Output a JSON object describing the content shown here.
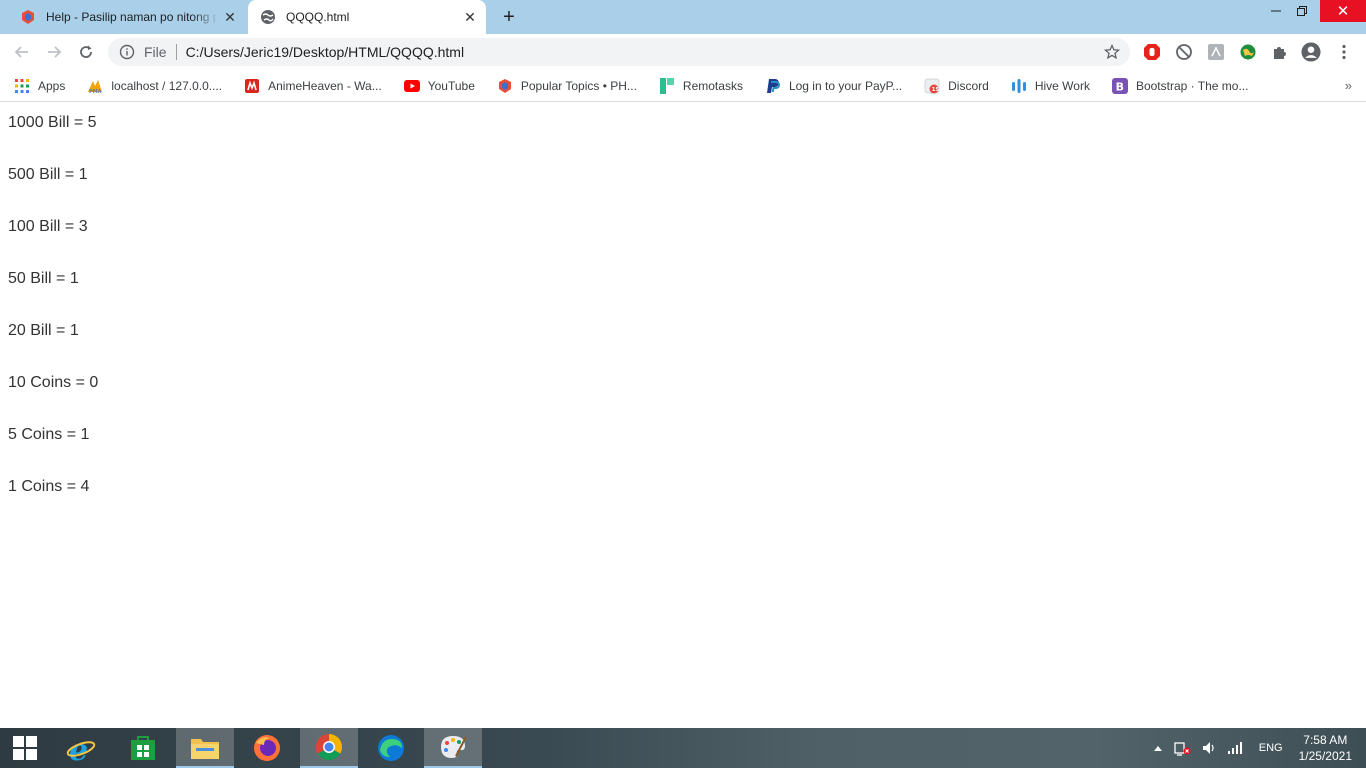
{
  "tabs": [
    {
      "title": "Help - Pasilip naman po nitong p",
      "favicon": "brainly-icon",
      "active": false
    },
    {
      "title": "QQQQ.html",
      "favicon": "globe-icon",
      "active": true
    }
  ],
  "omnibox": {
    "scheme_label": "File",
    "url": "C:/Users/Jeric19/Desktop/HTML/QQQQ.html"
  },
  "bookmarks": [
    {
      "label": "Apps",
      "icon": "apps-grid-icon"
    },
    {
      "label": "localhost / 127.0.0....",
      "icon": "phpmyadmin-icon"
    },
    {
      "label": "AnimeHeaven - Wa...",
      "icon": "animeheaven-icon"
    },
    {
      "label": "YouTube",
      "icon": "youtube-icon"
    },
    {
      "label": "Popular Topics • PH...",
      "icon": "brainly-icon"
    },
    {
      "label": "Remotasks",
      "icon": "remotasks-icon"
    },
    {
      "label": "Log in to your PayP...",
      "icon": "paypal-icon"
    },
    {
      "label": "Discord",
      "icon": "discord-icon"
    },
    {
      "label": "Hive Work",
      "icon": "hive-icon"
    },
    {
      "label": "Bootstrap · The mo...",
      "icon": "bootstrap-icon"
    }
  ],
  "content": {
    "lines": [
      "1000 Bill = 5",
      "500 Bill = 1",
      "100 Bill = 3",
      "50 Bill = 1",
      "20 Bill = 1",
      "10 Coins = 0",
      "5 Coins = 1",
      "1 Coins = 4"
    ]
  },
  "taskbar": {
    "apps": [
      "start-icon",
      "internet-explorer-icon",
      "store-icon",
      "file-explorer-icon",
      "firefox-icon",
      "chrome-icon",
      "edge-icon",
      "paint-icon"
    ],
    "language": "ENG",
    "time": "7:58 AM",
    "date": "1/25/2021"
  },
  "colors": {
    "tabstrip": "#a9cfe9",
    "close_button": "#e81123",
    "text": "#333333"
  }
}
